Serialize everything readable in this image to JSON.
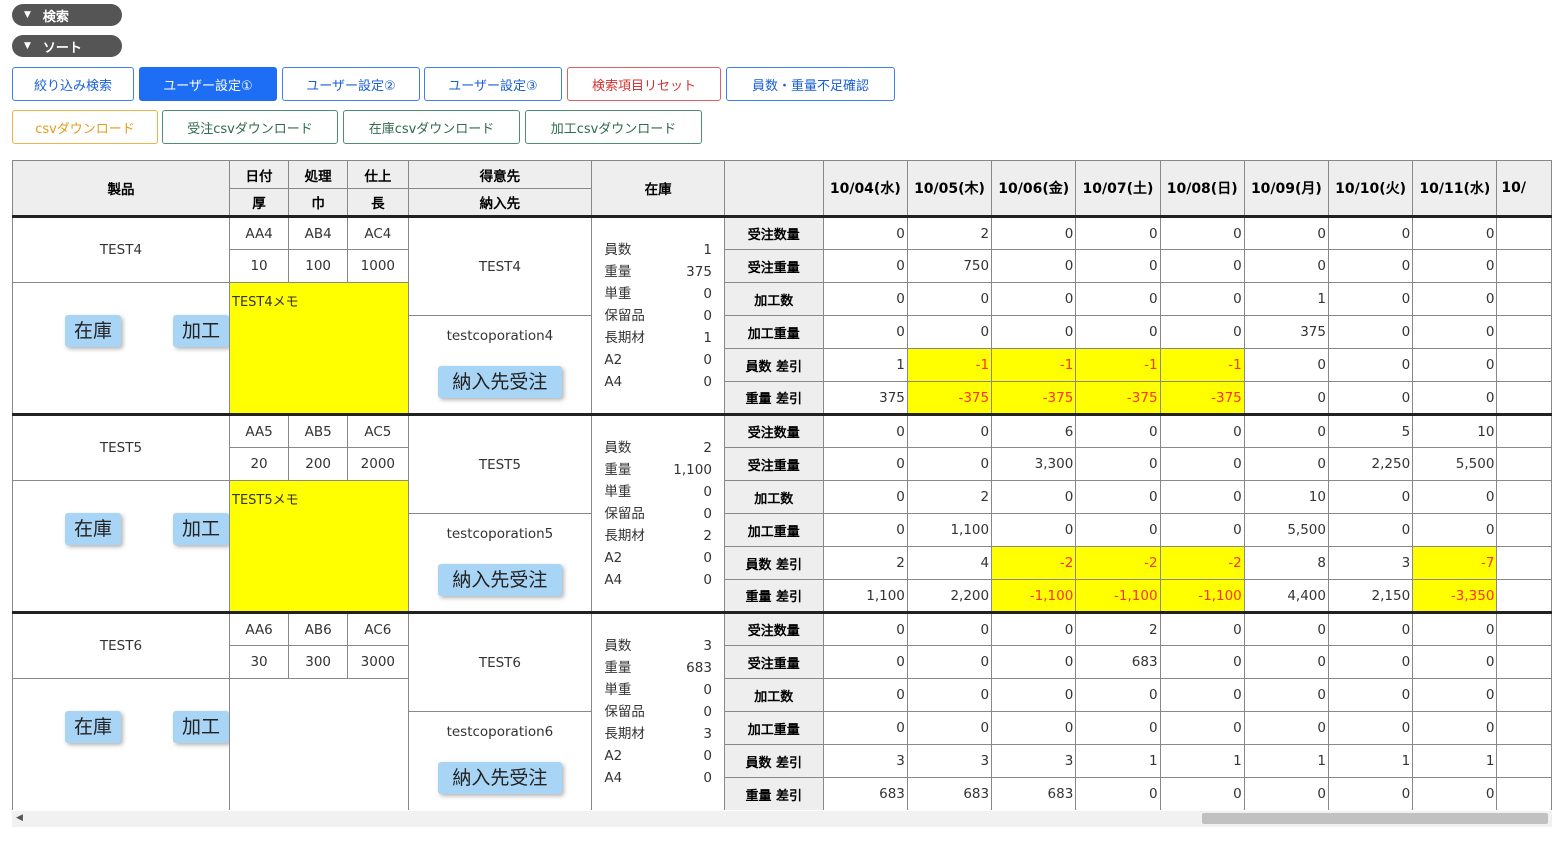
{
  "toggles": [
    {
      "label": "検索"
    },
    {
      "label": "ソート"
    }
  ],
  "buttons": {
    "row1": [
      {
        "label": "絞り込み検索",
        "style": "blue"
      },
      {
        "label": "ユーザー設定①",
        "style": "active"
      },
      {
        "label": "ユーザー設定②",
        "style": "blue"
      },
      {
        "label": "ユーザー設定③",
        "style": "blue"
      },
      {
        "label": "検索項目リセット",
        "style": "red"
      },
      {
        "label": "員数・重量不足確認",
        "style": "blue"
      }
    ],
    "row2": [
      {
        "label": "csvダウンロード",
        "style": "orange"
      },
      {
        "label": "受注csvダウンロード",
        "style": "green"
      },
      {
        "label": "在庫csvダウンロード",
        "style": "green"
      },
      {
        "label": "加工csvダウンロード",
        "style": "green"
      }
    ]
  },
  "table": {
    "headers": {
      "product": "製品",
      "date": "日付",
      "thickness": "厚",
      "process": "処理",
      "width": "巾",
      "finish": "仕上",
      "length": "長",
      "customer": "得意先",
      "ship_to": "納入先",
      "stock": "在庫",
      "dates": [
        "10/04(水)",
        "10/05(木)",
        "10/06(金)",
        "10/07(土)",
        "10/08(日)",
        "10/09(月)",
        "10/10(火)",
        "10/11(水)",
        "10/"
      ]
    },
    "action_labels": {
      "stock": "在庫",
      "process": "加工",
      "ship_order": "納入先受注"
    },
    "metric_labels": [
      "受注数量",
      "受注重量",
      "加工数",
      "加工重量",
      "員数 差引",
      "重量 差引"
    ],
    "stock_labels": [
      "員数",
      "重量",
      "単重",
      "保留品",
      "長期材",
      "A2",
      "A4"
    ],
    "products": [
      {
        "name": "TEST4",
        "codes": [
          "AA4",
          "AB4",
          "AC4"
        ],
        "dims": [
          "10",
          "100",
          "1000"
        ],
        "memo": "TEST4メモ",
        "customer": "TEST4",
        "ship_to": "testcoporation4",
        "stock": [
          "1",
          "375",
          "0",
          "0",
          "1",
          "0",
          "0"
        ],
        "rows": [
          [
            "0",
            "2",
            "0",
            "0",
            "0",
            "0",
            "0",
            "0"
          ],
          [
            "0",
            "750",
            "0",
            "0",
            "0",
            "0",
            "0",
            "0"
          ],
          [
            "0",
            "0",
            "0",
            "0",
            "0",
            "1",
            "0",
            "0"
          ],
          [
            "0",
            "0",
            "0",
            "0",
            "0",
            "375",
            "0",
            "0"
          ],
          [
            "1",
            "-1",
            "-1",
            "-1",
            "-1",
            "0",
            "0",
            "0"
          ],
          [
            "375",
            "-375",
            "-375",
            "-375",
            "-375",
            "0",
            "0",
            "0"
          ]
        ]
      },
      {
        "name": "TEST5",
        "codes": [
          "AA5",
          "AB5",
          "AC5"
        ],
        "dims": [
          "20",
          "200",
          "2000"
        ],
        "memo": "TEST5メモ",
        "customer": "TEST5",
        "ship_to": "testcoporation5",
        "stock": [
          "2",
          "1,100",
          "0",
          "0",
          "2",
          "0",
          "0"
        ],
        "rows": [
          [
            "0",
            "0",
            "6",
            "0",
            "0",
            "0",
            "5",
            "10"
          ],
          [
            "0",
            "0",
            "3,300",
            "0",
            "0",
            "0",
            "2,250",
            "5,500"
          ],
          [
            "0",
            "2",
            "0",
            "0",
            "0",
            "10",
            "0",
            "0"
          ],
          [
            "0",
            "1,100",
            "0",
            "0",
            "0",
            "5,500",
            "0",
            "0"
          ],
          [
            "2",
            "4",
            "-2",
            "-2",
            "-2",
            "8",
            "3",
            "-7"
          ],
          [
            "1,100",
            "2,200",
            "-1,100",
            "-1,100",
            "-1,100",
            "4,400",
            "2,150",
            "-3,350"
          ]
        ]
      },
      {
        "name": "TEST6",
        "codes": [
          "AA6",
          "AB6",
          "AC6"
        ],
        "dims": [
          "30",
          "300",
          "3000"
        ],
        "memo": "",
        "customer": "TEST6",
        "ship_to": "testcoporation6",
        "stock": [
          "3",
          "683",
          "0",
          "0",
          "3",
          "0",
          "0"
        ],
        "rows": [
          [
            "0",
            "0",
            "0",
            "2",
            "0",
            "0",
            "0",
            "0"
          ],
          [
            "0",
            "0",
            "0",
            "683",
            "0",
            "0",
            "0",
            "0"
          ],
          [
            "0",
            "0",
            "0",
            "0",
            "0",
            "0",
            "0",
            "0"
          ],
          [
            "0",
            "0",
            "0",
            "0",
            "0",
            "0",
            "0",
            "0"
          ],
          [
            "3",
            "3",
            "3",
            "1",
            "1",
            "1",
            "1",
            "1"
          ],
          [
            "683",
            "683",
            "683",
            "0",
            "0",
            "0",
            "0",
            "0"
          ]
        ]
      }
    ]
  },
  "colors": {
    "highlight": "#ffff00",
    "negative": "#ff3030",
    "active_button": "#1d6ef5",
    "chip": "#a8d4f5"
  }
}
